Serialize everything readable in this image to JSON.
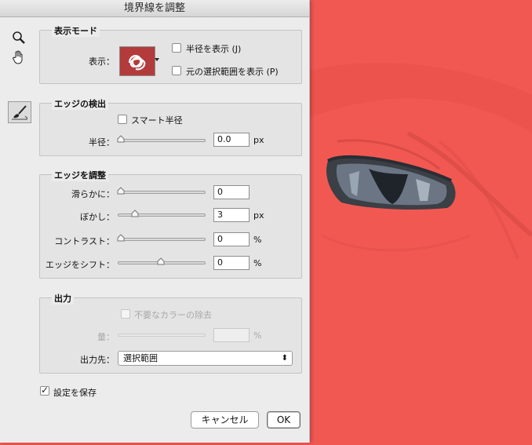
{
  "window": {
    "title": "境界線を調整"
  },
  "display_mode": {
    "title": "表示モード",
    "view_label": "表示：",
    "show_radius": "半径を表示 (J)",
    "show_original": "元の選択範囲を表示 (P)"
  },
  "edge_detection": {
    "title": "エッジの検出",
    "smart_radius": "スマート半径",
    "radius_label": "半径：",
    "radius_value": "0.0",
    "radius_unit": "px"
  },
  "adjust_edge": {
    "title": "エッジを調整",
    "smooth_label": "滑らかに：",
    "smooth_value": "0",
    "feather_label": "ぼかし：",
    "feather_value": "3",
    "feather_unit": "px",
    "contrast_label": "コントラスト：",
    "contrast_value": "0",
    "contrast_unit": "%",
    "shift_label": "エッジをシフト：",
    "shift_value": "0",
    "shift_unit": "%"
  },
  "output": {
    "title": "出力",
    "decontaminate": "不要なカラーの除去",
    "amount_label": "量：",
    "amount_value": "",
    "amount_unit": "%",
    "output_to_label": "出力先：",
    "output_to_value": "選択範囲",
    "select_arrows": "⬍"
  },
  "remember_settings": "設定を保存",
  "buttons": {
    "cancel": "キャンセル",
    "ok": "OK"
  },
  "sliders": {
    "radius": 0,
    "smooth": 0,
    "feather": 0.18,
    "contrast": 0,
    "shift": 0.5,
    "amount": 0
  },
  "colors": {
    "overlay": "#f25852",
    "dialog_bg": "#ececec"
  },
  "icons": {
    "zoom": "zoom-tool-icon",
    "hand": "hand-tool-icon",
    "brush": "refine-radius-brush-icon"
  }
}
